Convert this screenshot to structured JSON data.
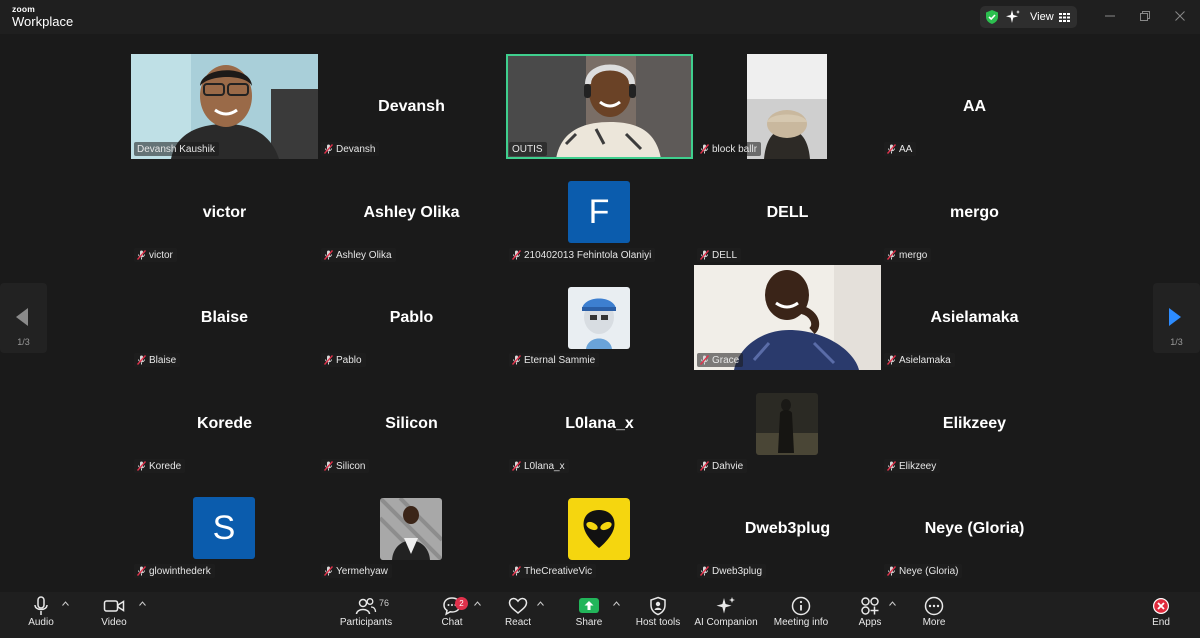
{
  "app": {
    "brand_top": "zoom",
    "brand_bottom": "Workplace"
  },
  "topbar": {
    "view_label": "View"
  },
  "pagination": {
    "left_page": "1/3",
    "right_page": "1/3"
  },
  "tiles": [
    {
      "name": "Devansh Kaushik",
      "display": "",
      "kind": "video",
      "muted": false
    },
    {
      "name": "Devansh",
      "display": "Devansh",
      "kind": "name",
      "muted": true
    },
    {
      "name": "OUTIS",
      "display": "",
      "kind": "video",
      "muted": false
    },
    {
      "name": "block ballr",
      "display": "",
      "kind": "video",
      "muted": true
    },
    {
      "name": "AA",
      "display": "AA",
      "kind": "name",
      "muted": true
    },
    {
      "name": "victor",
      "display": "victor",
      "kind": "name",
      "muted": true
    },
    {
      "name": "Ashley Olika",
      "display": "Ashley Olika",
      "kind": "name",
      "muted": true
    },
    {
      "name": "210402013 Fehintola Olaniyi",
      "display": "F",
      "kind": "letter",
      "muted": true,
      "color": "#0b5cad"
    },
    {
      "name": "DELL",
      "display": "DELL",
      "kind": "name",
      "muted": true
    },
    {
      "name": "mergo",
      "display": "mergo",
      "kind": "name",
      "muted": true
    },
    {
      "name": "Blaise",
      "display": "Blaise",
      "kind": "name",
      "muted": true
    },
    {
      "name": "Pablo",
      "display": "Pablo",
      "kind": "name",
      "muted": true
    },
    {
      "name": "Eternal Sammie",
      "display": "",
      "kind": "picture",
      "muted": true
    },
    {
      "name": "Grace",
      "display": "",
      "kind": "video",
      "muted": true
    },
    {
      "name": "Asielamaka",
      "display": "Asielamaka",
      "kind": "name",
      "muted": true
    },
    {
      "name": "Korede",
      "display": "Korede",
      "kind": "name",
      "muted": true
    },
    {
      "name": "Silicon",
      "display": "Silicon",
      "kind": "name",
      "muted": true
    },
    {
      "name": "L0lana_x",
      "display": "L0lana_x",
      "kind": "name",
      "muted": true
    },
    {
      "name": "Dahvie",
      "display": "",
      "kind": "picture",
      "muted": true
    },
    {
      "name": "Elikzeey",
      "display": "Elikzeey",
      "kind": "name",
      "muted": true
    },
    {
      "name": "glowinthederk",
      "display": "S",
      "kind": "letter",
      "muted": true,
      "color": "#0b5cad"
    },
    {
      "name": "Yermehyaw",
      "display": "",
      "kind": "picture",
      "muted": true
    },
    {
      "name": "TheCreativeVic",
      "display": "",
      "kind": "picture",
      "muted": true
    },
    {
      "name": "Dweb3plug",
      "display": "Dweb3plug",
      "kind": "name",
      "muted": true
    },
    {
      "name": "Neye (Gloria)",
      "display": "Neye (Gloria)",
      "kind": "name",
      "muted": true
    }
  ],
  "toolbar": {
    "audio": "Audio",
    "video": "Video",
    "participants": "Participants",
    "participants_count": "76",
    "chat": "Chat",
    "chat_badge": "2",
    "react": "React",
    "share": "Share",
    "host_tools": "Host tools",
    "ai_companion": "AI Companion",
    "meeting_info": "Meeting info",
    "apps": "Apps",
    "more": "More",
    "end": "End"
  },
  "colors": {
    "active_speaker": "#3fcf8e",
    "share_green": "#22b55a",
    "end_red": "#e02a3c",
    "avatar_blue": "#0b5cad",
    "arrow_blue": "#2d8cff"
  }
}
